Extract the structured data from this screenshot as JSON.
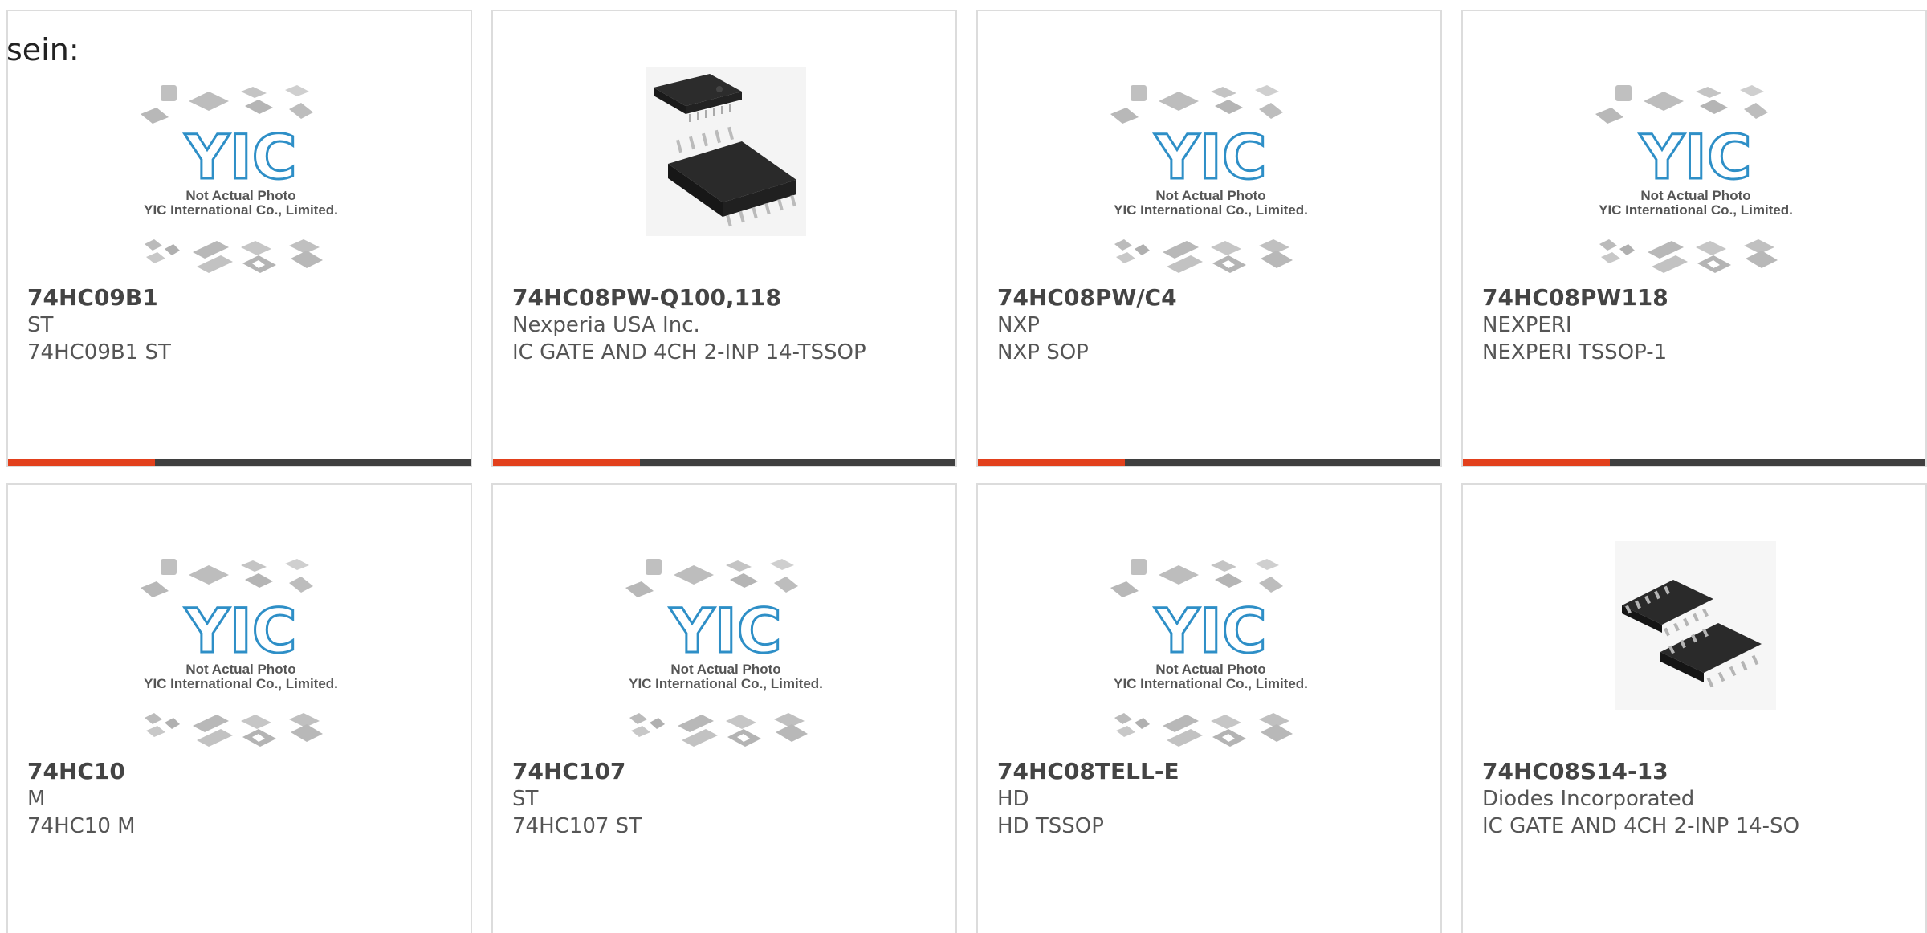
{
  "intro_text": "sein:",
  "placeholder": {
    "line1": "Not Actual Photo",
    "line2": "YIC International Co., Limited.",
    "logo_text": "YIC"
  },
  "colors": {
    "accent": "#e2401c",
    "bar": "#3f3f3f",
    "logo": "#2e8fc7"
  },
  "products": [
    {
      "pn": "74HC09B1",
      "mfr": "ST",
      "desc": "74HC09B1 ST",
      "image": "placeholder"
    },
    {
      "pn": "74HC08PW-Q100,118",
      "mfr": "Nexperia USA Inc.",
      "desc": "IC GATE AND 4CH 2-INP 14-TSSOP",
      "image": "tssop-chip"
    },
    {
      "pn": "74HC08PW/C4",
      "mfr": "NXP",
      "desc": "NXP SOP",
      "image": "placeholder"
    },
    {
      "pn": "74HC08PW118",
      "mfr": "NEXPERI",
      "desc": "NEXPERI TSSOP-1",
      "image": "placeholder"
    },
    {
      "pn": "74HC10",
      "mfr": "M",
      "desc": "74HC10 M",
      "image": "placeholder"
    },
    {
      "pn": "74HC107",
      "mfr": "ST",
      "desc": "74HC107 ST",
      "image": "placeholder"
    },
    {
      "pn": "74HC08TELL-E",
      "mfr": "HD",
      "desc": "HD TSSOP",
      "image": "placeholder"
    },
    {
      "pn": "74HC08S14-13",
      "mfr": "Diodes Incorporated",
      "desc": "IC GATE AND 4CH 2-INP 14-SO",
      "image": "soic-chip"
    }
  ]
}
